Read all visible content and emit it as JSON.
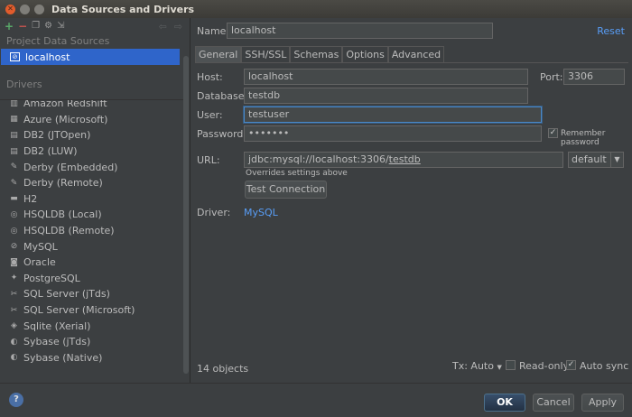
{
  "window": {
    "title": "Data Sources and Drivers"
  },
  "left": {
    "project_section": "Project Data Sources",
    "selected_source": "localhost",
    "drivers_section": "Drivers",
    "drivers": [
      {
        "label": "Amazon Redshift",
        "icon": "redshift-icon"
      },
      {
        "label": "Azure (Microsoft)",
        "icon": "azure-icon"
      },
      {
        "label": "DB2 (JTOpen)",
        "icon": "db2-icon"
      },
      {
        "label": "DB2 (LUW)",
        "icon": "db2-icon"
      },
      {
        "label": "Derby (Embedded)",
        "icon": "derby-icon"
      },
      {
        "label": "Derby (Remote)",
        "icon": "derby-icon"
      },
      {
        "label": "H2",
        "icon": "h2-icon"
      },
      {
        "label": "HSQLDB (Local)",
        "icon": "hsqldb-icon"
      },
      {
        "label": "HSQLDB (Remote)",
        "icon": "hsqldb-icon"
      },
      {
        "label": "MySQL",
        "icon": "mysql-icon"
      },
      {
        "label": "Oracle",
        "icon": "oracle-icon"
      },
      {
        "label": "PostgreSQL",
        "icon": "postgresql-icon"
      },
      {
        "label": "SQL Server (jTds)",
        "icon": "sqlserver-icon"
      },
      {
        "label": "SQL Server (Microsoft)",
        "icon": "sqlserver-icon"
      },
      {
        "label": "Sqlite (Xerial)",
        "icon": "sqlite-icon"
      },
      {
        "label": "Sybase (jTds)",
        "icon": "sybase-icon"
      },
      {
        "label": "Sybase (Native)",
        "icon": "sybase-icon"
      }
    ]
  },
  "form": {
    "name_label": "Name:",
    "name_value": "localhost",
    "reset_label": "Reset",
    "tabs": [
      "General",
      "SSH/SSL",
      "Schemas",
      "Options",
      "Advanced"
    ],
    "host_label": "Host:",
    "host_value": "localhost",
    "port_label": "Port:",
    "port_value": "3306",
    "database_label": "Database:",
    "database_value": "testdb",
    "user_label": "User:",
    "user_value": "testuser",
    "password_label": "Password:",
    "password_value": "•••••••",
    "remember_label": "Remember password",
    "url_label": "URL:",
    "url_prefix": "jdbc:mysql://localhost:3306/",
    "url_db": "testdb",
    "url_mode": "default",
    "url_hint": "Overrides settings above",
    "test_button": "Test Connection",
    "driver_label": "Driver:",
    "driver_value": "MySQL",
    "objects_count": "14 objects",
    "tx_label": "Tx: Auto",
    "readonly_label": "Read-only",
    "autosync_label": "Auto sync"
  },
  "footer": {
    "help": "?",
    "ok": "OK",
    "cancel": "Cancel",
    "apply": "Apply"
  }
}
